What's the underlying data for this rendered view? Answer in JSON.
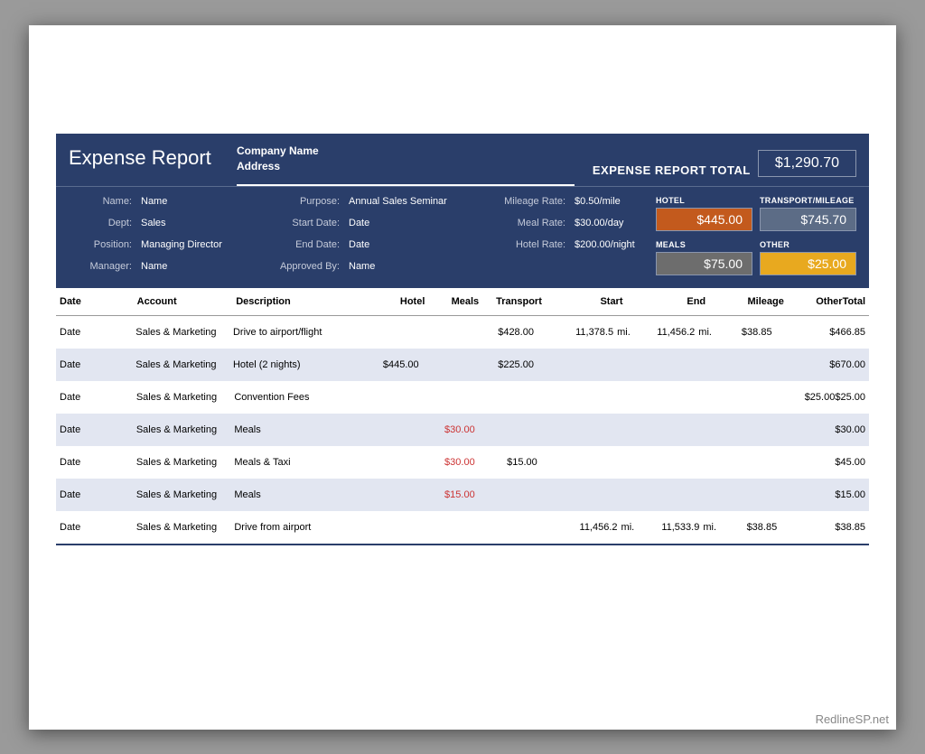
{
  "header": {
    "title": "Expense Report",
    "company": "Company Name",
    "address": "Address",
    "total_label": "EXPENSE REPORT TOTAL",
    "total_value": "$1,290.70"
  },
  "info": {
    "name_label": "Name:",
    "name_value": "Name",
    "dept_label": "Dept:",
    "dept_value": "Sales",
    "position_label": "Position:",
    "position_value": "Managing Director",
    "manager_label": "Manager:",
    "manager_value": "Name",
    "purpose_label": "Purpose:",
    "purpose_value": "Annual Sales Seminar",
    "start_label": "Start Date:",
    "start_value": "Date",
    "end_label": "End Date:",
    "end_value": "Date",
    "approved_label": "Approved By:",
    "approved_value": "Name",
    "mileage_rate_label": "Mileage Rate:",
    "mileage_rate_value": "$0.50/mile",
    "meal_rate_label": "Meal Rate:",
    "meal_rate_value": "$30.00/day",
    "hotel_rate_label": "Hotel Rate:",
    "hotel_rate_value": "$200.00/night"
  },
  "summary": {
    "hotel_label": "HOTEL",
    "hotel_value": "$445.00",
    "transport_label": "TRANSPORT/MILEAGE",
    "transport_value": "$745.70",
    "meals_label": "MEALS",
    "meals_value": "$75.00",
    "other_label": "OTHER",
    "other_value": "$25.00"
  },
  "table": {
    "headers": {
      "date": "Date",
      "account": "Account",
      "description": "Description",
      "hotel": "Hotel",
      "meals": "Meals",
      "transport": "Transport",
      "start": "Start",
      "end": "End",
      "mileage": "Mileage",
      "other": "Other",
      "total": "Total"
    },
    "rows": [
      {
        "date": "Date",
        "account": "Sales & Marketing",
        "description": "Drive to airport/flight",
        "hotel": "",
        "meals": "",
        "meals_red": false,
        "transport": "$428.00",
        "start": "11,378.5",
        "start_unit": "mi.",
        "end": "11,456.2",
        "end_unit": "mi.",
        "mileage": "$38.85",
        "other": "",
        "total": "$466.85"
      },
      {
        "date": "Date",
        "account": "Sales & Marketing",
        "description": "Hotel (2 nights)",
        "hotel": "$445.00",
        "meals": "",
        "meals_red": false,
        "transport": "$225.00",
        "start": "",
        "start_unit": "",
        "end": "",
        "end_unit": "",
        "mileage": "",
        "other": "",
        "total": "$670.00"
      },
      {
        "date": "Date",
        "account": "Sales & Marketing",
        "description": "Convention Fees",
        "hotel": "",
        "meals": "",
        "meals_red": false,
        "transport": "",
        "start": "",
        "start_unit": "",
        "end": "",
        "end_unit": "",
        "mileage": "",
        "other": "$25.00",
        "total": "$25.00"
      },
      {
        "date": "Date",
        "account": "Sales & Marketing",
        "description": "Meals",
        "hotel": "",
        "meals": "$30.00",
        "meals_red": true,
        "transport": "",
        "start": "",
        "start_unit": "",
        "end": "",
        "end_unit": "",
        "mileage": "",
        "other": "",
        "total": "$30.00"
      },
      {
        "date": "Date",
        "account": "Sales & Marketing",
        "description": "Meals & Taxi",
        "hotel": "",
        "meals": "$30.00",
        "meals_red": true,
        "transport": "$15.00",
        "start": "",
        "start_unit": "",
        "end": "",
        "end_unit": "",
        "mileage": "",
        "other": "",
        "total": "$45.00"
      },
      {
        "date": "Date",
        "account": "Sales & Marketing",
        "description": "Meals",
        "hotel": "",
        "meals": "$15.00",
        "meals_red": true,
        "transport": "",
        "start": "",
        "start_unit": "",
        "end": "",
        "end_unit": "",
        "mileage": "",
        "other": "",
        "total": "$15.00"
      },
      {
        "date": "Date",
        "account": "Sales & Marketing",
        "description": "Drive from airport",
        "hotel": "",
        "meals": "",
        "meals_red": false,
        "transport": "",
        "start": "11,456.2",
        "start_unit": "mi.",
        "end": "11,533.9",
        "end_unit": "mi.",
        "mileage": "$38.85",
        "other": "",
        "total": "$38.85"
      }
    ]
  },
  "watermark": "RedlineSP.net"
}
